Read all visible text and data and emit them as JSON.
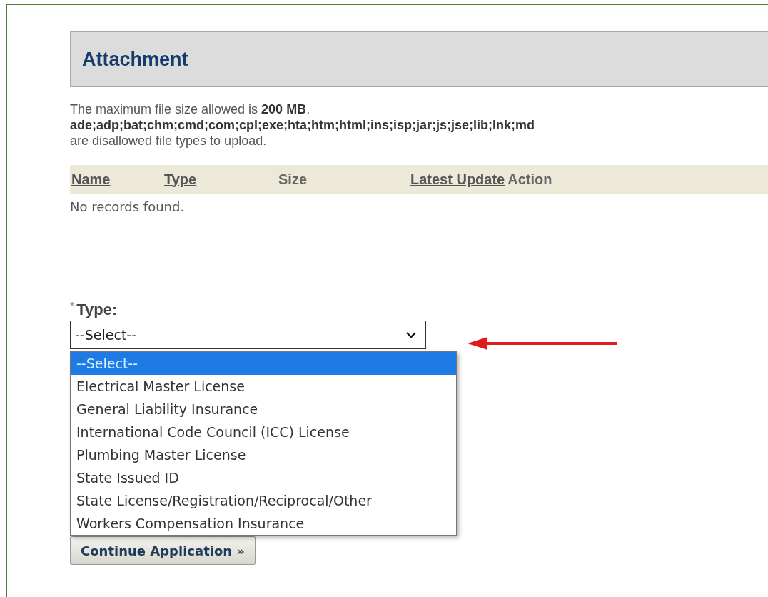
{
  "section": {
    "title": "Attachment"
  },
  "notice": {
    "size_line": "The maximum file size allowed is **200 MB**.",
    "types_line": "ade;adp;bat;chm;cmd;com;cpl;exe;hta;htm;html;ins;isp;jar;js;jse;lib;lnk;md",
    "suffix_line": "are disallowed file types to upload."
  },
  "table": {
    "columns": [
      {
        "label": "Name",
        "sortable": true
      },
      {
        "label": "Type",
        "sortable": true
      },
      {
        "label": "Size",
        "sortable": false
      },
      {
        "label": "Latest Update",
        "sortable": true
      },
      {
        "label": "Action",
        "sortable": false
      }
    ],
    "empty_message": "No records found."
  },
  "type_field": {
    "required_mark": "*",
    "label": "Type:",
    "value": "--Select--",
    "expanded": true,
    "options": [
      {
        "label": "--Select--",
        "selected": true
      },
      {
        "label": "Electrical Master License",
        "selected": false
      },
      {
        "label": "General Liability Insurance",
        "selected": false
      },
      {
        "label": "International Code Council (ICC) License",
        "selected": false
      },
      {
        "label": "Plumbing Master License",
        "selected": false
      },
      {
        "label": "State Issued ID",
        "selected": false
      },
      {
        "label": "State License/Registration/Reciprocal/Other",
        "selected": false
      },
      {
        "label": "Workers Compensation Insurance",
        "selected": false
      }
    ]
  },
  "continue_button": {
    "label": "Continue Application »"
  }
}
